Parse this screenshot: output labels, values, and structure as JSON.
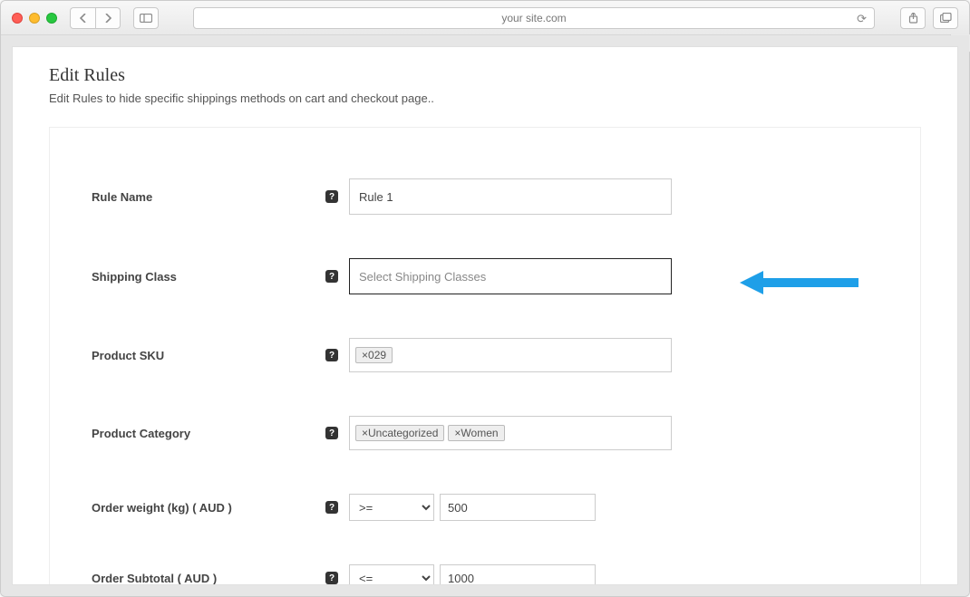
{
  "browser": {
    "url": "your site.com"
  },
  "page": {
    "title": "Edit Rules",
    "subtitle": "Edit Rules to hide specific shippings methods on cart and checkout page.."
  },
  "form": {
    "rule_name": {
      "label": "Rule Name",
      "value": "Rule 1"
    },
    "shipping_class": {
      "label": "Shipping Class",
      "placeholder": "Select Shipping Classes"
    },
    "product_sku": {
      "label": "Product SKU",
      "tags": [
        "029"
      ]
    },
    "product_category": {
      "label": "Product Category",
      "tags": [
        "Uncategorized",
        "Women"
      ]
    },
    "order_weight": {
      "label": "Order weight (kg) ( AUD )",
      "op": ">=",
      "value": "500"
    },
    "order_subtotal": {
      "label": "Order Subtotal ( AUD )",
      "op": "<=",
      "value": "1000"
    }
  }
}
